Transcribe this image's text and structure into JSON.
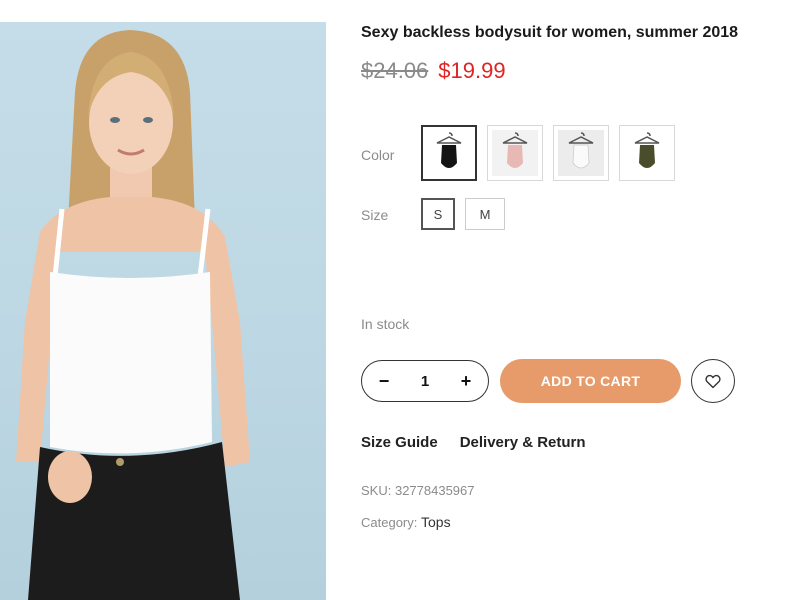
{
  "product": {
    "title": "Sexy backless bodysuit for women, summer 2018",
    "old_price": "$24.06",
    "new_price": "$19.99"
  },
  "options": {
    "color_label": "Color",
    "size_label": "Size",
    "colors": [
      {
        "name": "black",
        "hex": "#141414",
        "selected": true
      },
      {
        "name": "pink",
        "hex": "#e8b9b4",
        "selected": false
      },
      {
        "name": "white",
        "hex": "#f4f4f4",
        "selected": false
      },
      {
        "name": "olive",
        "hex": "#4a4d2a",
        "selected": false
      }
    ],
    "sizes": [
      "S",
      "M"
    ],
    "selected_size": "S"
  },
  "stock": {
    "status": "In stock"
  },
  "cart": {
    "minus": "−",
    "plus": "+",
    "quantity": "1",
    "add_label": "ADD TO CART",
    "button_color": "#e79b6b"
  },
  "links": {
    "size_guide": "Size Guide",
    "delivery": "Delivery & Return"
  },
  "meta": {
    "sku_label": "SKU:",
    "sku_value": "32778435967",
    "category_label": "Category:",
    "category_value": "Tops"
  },
  "icons": {
    "wishlist": "heart-icon"
  }
}
